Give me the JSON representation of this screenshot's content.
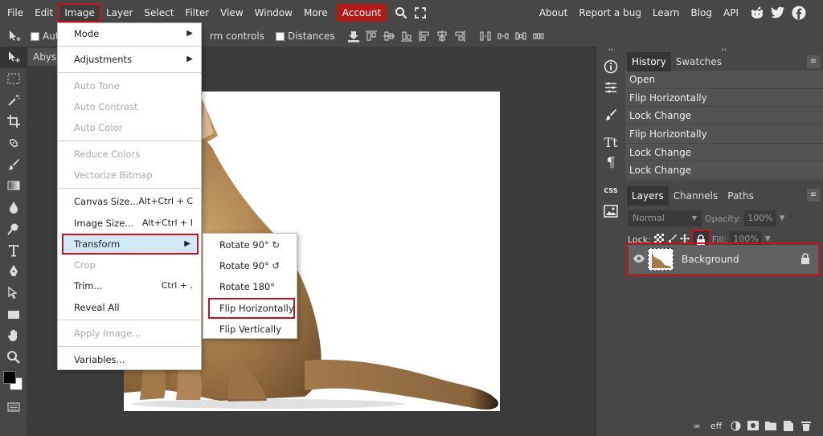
{
  "menubar": {
    "items": [
      "File",
      "Edit",
      "Image",
      "Layer",
      "Select",
      "Filter",
      "View",
      "Window",
      "More"
    ],
    "account_label": "Account",
    "right_links": [
      "About",
      "Report a bug",
      "Learn",
      "Blog",
      "API"
    ],
    "social_icons": [
      "reddit-icon",
      "twitter-icon",
      "facebook-icon"
    ]
  },
  "options": {
    "auto_select_label": "Auto",
    "transform_controls_label": "rm controls",
    "distances_label": "Distances"
  },
  "document": {
    "tab_label": "Abyss"
  },
  "history": {
    "tabs": [
      "History",
      "Swatches"
    ],
    "items": [
      "Open",
      "Flip Horizontally",
      "Lock Change",
      "Flip Horizontally",
      "Lock Change",
      "Lock Change"
    ]
  },
  "layers": {
    "tabs": [
      "Layers",
      "Channels",
      "Paths"
    ],
    "blend_mode": "Normal",
    "opacity_label": "Opacity:",
    "opacity_value": "100%",
    "lock_label": "Lock:",
    "fill_label": "Fill:",
    "fill_value": "100%",
    "layer_name": "Background",
    "footer_labels": [
      "eff"
    ]
  },
  "image_menu": {
    "items": [
      {
        "label": "Mode",
        "submenu": true,
        "enabled": true
      },
      {
        "label": "Adjustments",
        "submenu": true,
        "enabled": true
      },
      {
        "label": "Auto Tone",
        "enabled": false
      },
      {
        "label": "Auto Contrast",
        "enabled": false
      },
      {
        "label": "Auto Color",
        "enabled": false
      },
      {
        "label": "Reduce Colors",
        "enabled": false
      },
      {
        "label": "Vectorize Bitmap",
        "enabled": false
      },
      {
        "label": "Canvas Size...",
        "shortcut": "Alt+Ctrl + C",
        "enabled": true
      },
      {
        "label": "Image Size...",
        "shortcut": "Alt+Ctrl + I",
        "enabled": true
      },
      {
        "label": "Transform",
        "submenu": true,
        "enabled": true,
        "selected": true
      },
      {
        "label": "Crop",
        "enabled": false
      },
      {
        "label": "Trim...",
        "shortcut": "Ctrl + .",
        "enabled": true
      },
      {
        "label": "Reveal All",
        "enabled": true
      },
      {
        "label": "Apply Image...",
        "enabled": false
      },
      {
        "label": "Variables...",
        "enabled": true
      }
    ]
  },
  "transform_menu": {
    "items": [
      "Rotate 90° ↻",
      "Rotate 90° ↺",
      "Rotate 180°",
      "Flip Horizontally",
      "Flip Vertically"
    ],
    "selected": "Flip Horizontally"
  },
  "colors": {
    "accent_red": "#c9121f",
    "account_bg": "#b21a1a",
    "menu_selected_bg": "#d0e8f8"
  }
}
